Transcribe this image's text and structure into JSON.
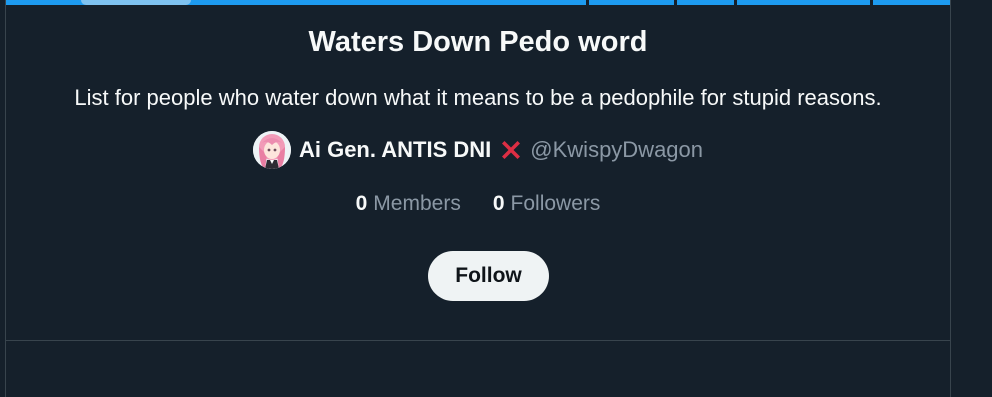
{
  "list": {
    "title": "Waters Down Pedo word",
    "description": "List for people who water down what it means to be a pedophile for stupid reasons."
  },
  "owner": {
    "display_name": "Ai Gen. ANTIS DNI",
    "name_emoji_icon": "cross-mark-icon",
    "handle": "@KwispyDwagon"
  },
  "stats": {
    "members_count": "0",
    "members_label": "Members",
    "followers_count": "0",
    "followers_label": "Followers"
  },
  "actions": {
    "follow_label": "Follow"
  },
  "colors": {
    "background": "#15202b",
    "border": "#38444d",
    "text_primary": "#f7f9f9",
    "text_secondary": "#8b98a5",
    "banner": "#1d9bf0",
    "button_bg": "#eff3f4",
    "cross": "#dd2e44"
  }
}
